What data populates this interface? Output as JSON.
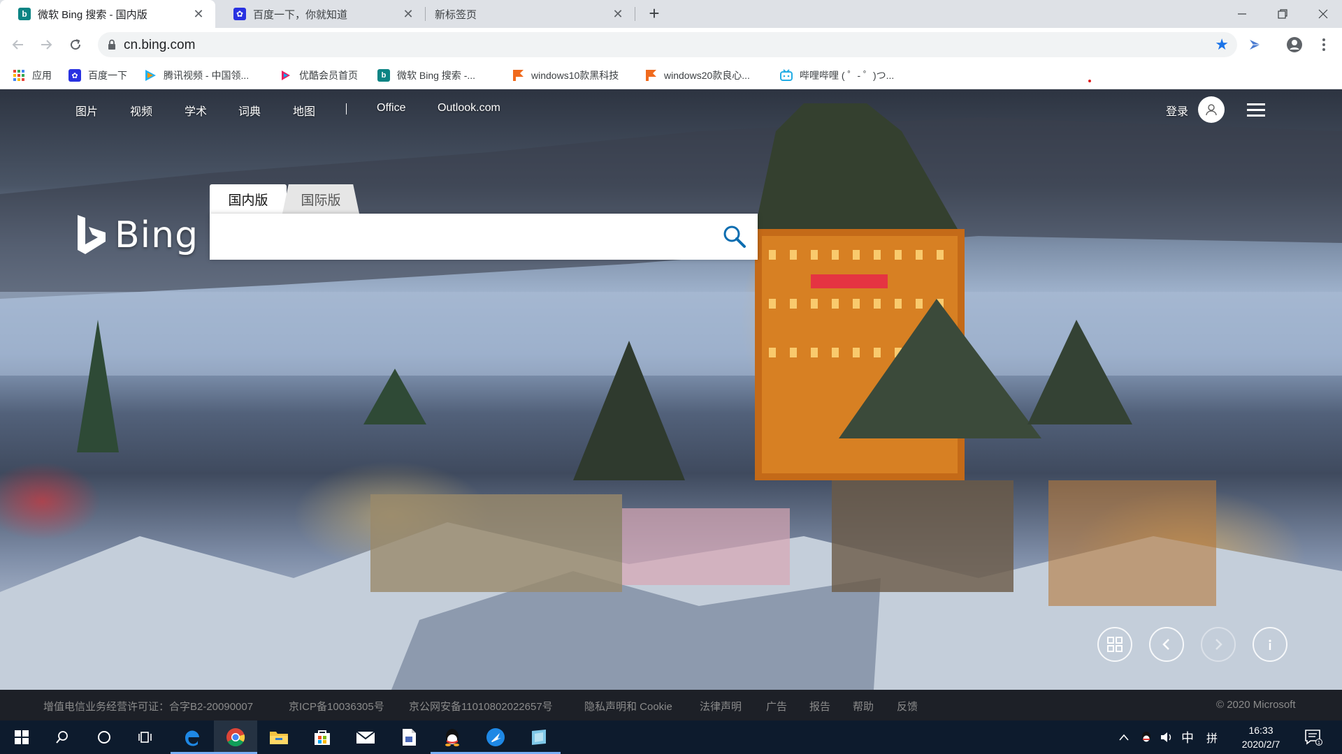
{
  "browser": {
    "tabs": [
      {
        "title": "微软 Bing 搜索 - 国内版",
        "favicon": "bing-icon",
        "active": true
      },
      {
        "title": "百度一下，你就知道",
        "favicon": "baidu-icon",
        "active": false
      },
      {
        "title": "新标签页",
        "favicon": "none",
        "active": false
      }
    ],
    "new_tab_label": "+",
    "url": "cn.bing.com",
    "bookmarks": [
      {
        "label": "应用",
        "icon": "apps-grid-icon"
      },
      {
        "label": "百度一下",
        "icon": "baidu-icon"
      },
      {
        "label": "腾讯视频 - 中国领...",
        "icon": "tencent-video-icon"
      },
      {
        "label": "优酷会员首页",
        "icon": "youku-icon"
      },
      {
        "label": "微软 Bing 搜索 -...",
        "icon": "bing-icon"
      },
      {
        "label": "windows10款黑科技",
        "icon": "flag-icon"
      },
      {
        "label": "windows20款良心...",
        "icon": "flag-icon"
      },
      {
        "label": "哔哩哔哩 ( ゜- ゜)つ...",
        "icon": "bilibili-icon"
      }
    ]
  },
  "bing": {
    "nav": [
      "图片",
      "视频",
      "学术",
      "词典",
      "地图",
      "Office",
      "Outlook.com"
    ],
    "login": "登录",
    "logo_text": "Bing",
    "scope_tabs": [
      "国内版",
      "国际版"
    ],
    "search_value": "",
    "footer": [
      "增值电信业务经营许可证：合字B2-20090007",
      "京ICP备10036305号",
      "京公网安备11010802022657号",
      "隐私声明和 Cookie",
      "法律声明",
      "广告",
      "报告",
      "帮助",
      "反馈"
    ],
    "copyright": "© 2020 Microsoft"
  },
  "taskbar": {
    "apps": [
      "windows-start-icon",
      "search-icon",
      "cortana-icon",
      "task-view-icon",
      "edge-icon",
      "chrome-icon",
      "file-explorer-icon",
      "store-icon",
      "mail-icon",
      "document-icon",
      "qq-icon",
      "feishu-icon",
      "app-icon"
    ],
    "ime": "中",
    "ime_mode": "拼",
    "time": "16:33",
    "date": "2020/2/7"
  },
  "colors": {
    "chrome_accent": "#1a73e8",
    "bing_blue": "#0078d7",
    "taskbar": "#0d1b2d"
  }
}
